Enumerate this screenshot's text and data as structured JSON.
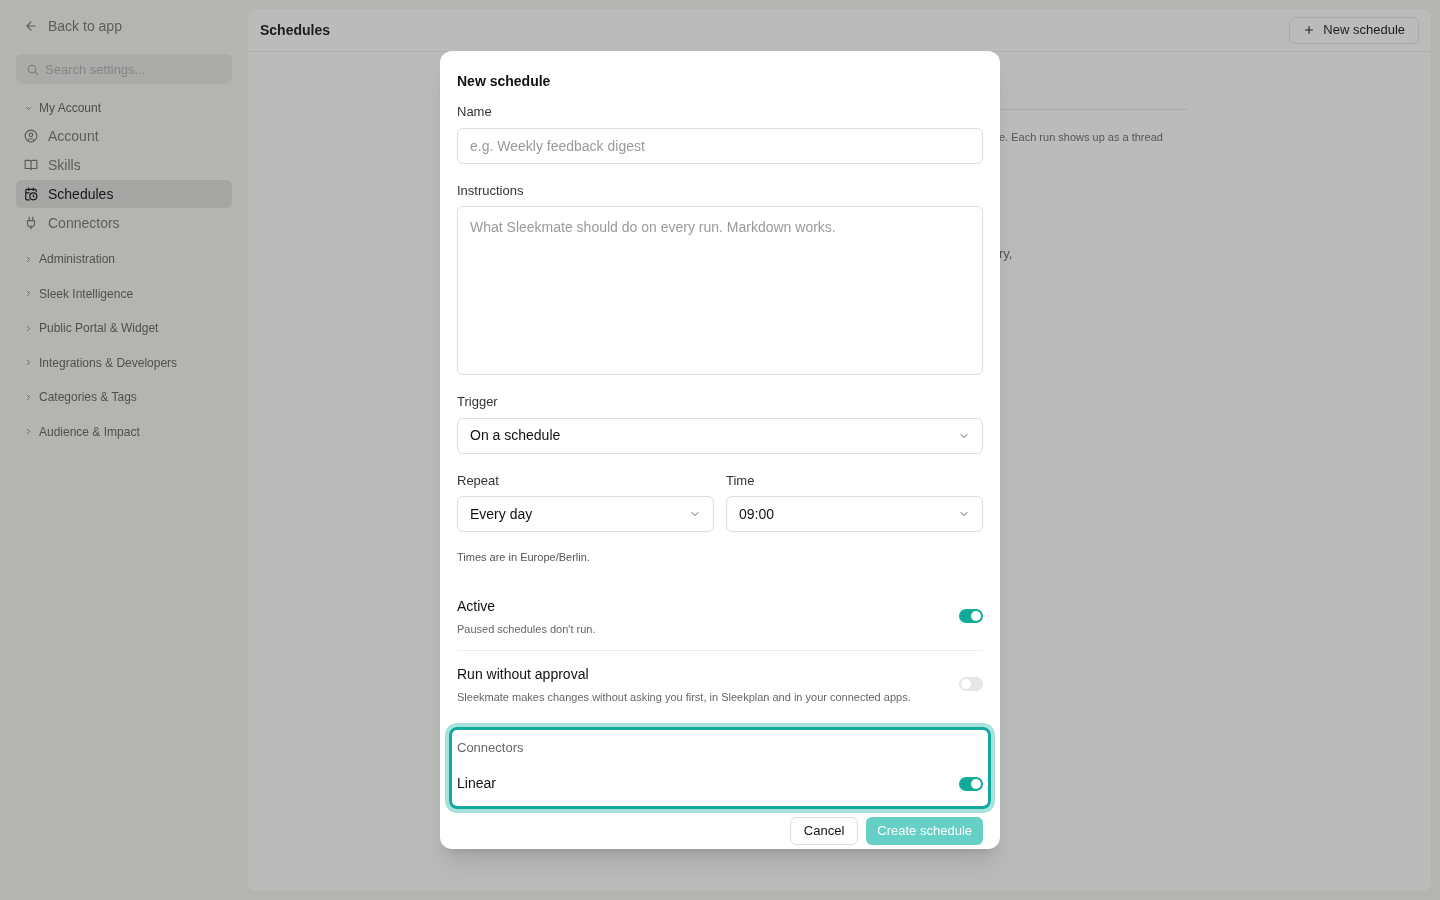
{
  "sidebar": {
    "back_link": "Back to app",
    "search": {
      "placeholder": "Search settings..."
    },
    "groups": [
      {
        "label": "My Account",
        "expanded": true,
        "children": [
          {
            "label": "Account",
            "selected": false
          },
          {
            "label": "Skills",
            "selected": false
          },
          {
            "label": "Schedules",
            "selected": true
          },
          {
            "label": "Connectors",
            "selected": false
          }
        ]
      },
      {
        "label": "Administration",
        "expanded": false
      },
      {
        "label": "Sleek Intelligence",
        "expanded": false
      },
      {
        "label": "Public Portal & Widget",
        "expanded": false
      },
      {
        "label": "Integrations & Developers",
        "expanded": false
      },
      {
        "label": "Categories & Tags",
        "expanded": false
      },
      {
        "label": "Audience & Impact",
        "expanded": false
      }
    ]
  },
  "header": {
    "title": "Schedules",
    "new_button": "New schedule"
  },
  "background_texts": [
    "e. Each run shows up as a thread",
    "ry,"
  ],
  "dialog": {
    "title": "New schedule",
    "name": {
      "label": "Name",
      "placeholder": "e.g. Weekly feedback digest"
    },
    "instructions": {
      "label": "Instructions",
      "placeholder": "What Sleekmate should do on every run. Markdown works."
    },
    "trigger": {
      "label": "Trigger",
      "value": "On a schedule"
    },
    "repeat": {
      "label": "Repeat",
      "value": "Every day"
    },
    "time": {
      "label": "Time",
      "value": "09:00"
    },
    "timezone_note": "Times are in Europe/Berlin.",
    "toggles": [
      {
        "label": "Active",
        "description": "Paused schedules don't run.",
        "on": true
      },
      {
        "label": "Run without approval",
        "description": "Sleekmate makes changes without asking you first, in Sleekplan and in your connected apps.",
        "on": false
      }
    ],
    "connectors": {
      "label": "Connectors",
      "focused": true,
      "items": [
        {
          "label": "Linear",
          "on": true
        }
      ]
    },
    "buttons": {
      "cancel": "Cancel",
      "create": "Create schedule",
      "create_disabled": true
    }
  }
}
